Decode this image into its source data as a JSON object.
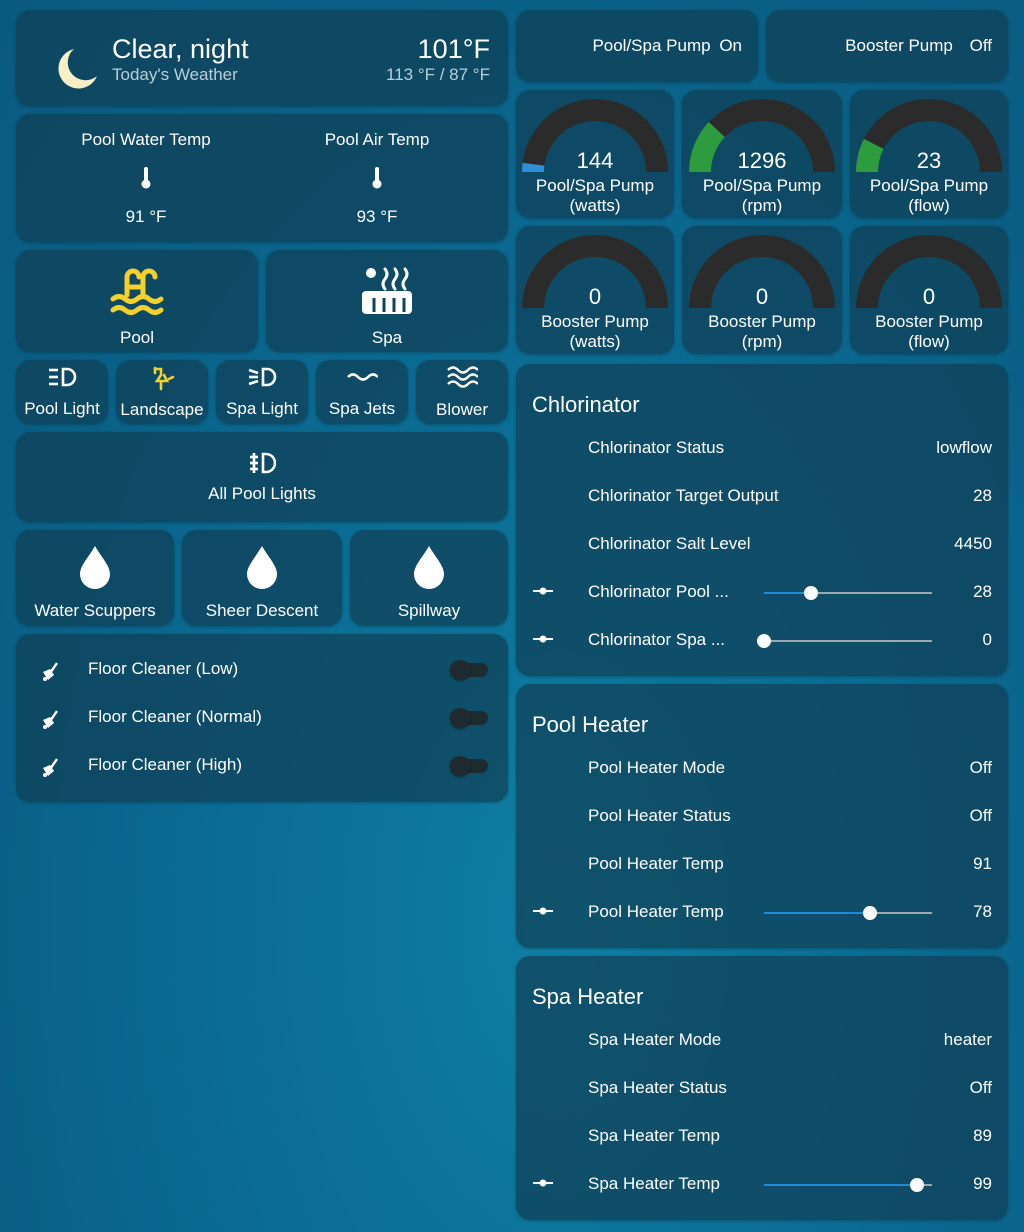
{
  "weather": {
    "condition": "Clear, night",
    "subtitle": "Today's Weather",
    "temperature": "101°F",
    "range": "113 °F / 87 °F",
    "icon": "moon-icon"
  },
  "temps": {
    "water_label": "Pool Water Temp",
    "water_value": "91 °F",
    "air_label": "Pool Air Temp",
    "air_value": "93 °F"
  },
  "modes": {
    "pool_label": "Pool",
    "spa_label": "Spa",
    "accent_color": "#f5d02c"
  },
  "lights": [
    {
      "label": "Pool Light",
      "icon": "headlight-icon"
    },
    {
      "label": "Landscape",
      "icon": "outdoor-lamp-icon"
    },
    {
      "label": "Spa Light",
      "icon": "headlight-icon"
    },
    {
      "label": "Spa Jets",
      "icon": "wave-icon"
    },
    {
      "label": "Blower",
      "icon": "waves-icon"
    }
  ],
  "all_lights": {
    "label": "All Pool Lights",
    "icon": "fog-light-icon"
  },
  "features": [
    {
      "label": "Water Scuppers",
      "icon": "water-drop-icon"
    },
    {
      "label": "Sheer Descent",
      "icon": "water-drop-icon"
    },
    {
      "label": "Spillway",
      "icon": "water-drop-icon"
    }
  ],
  "cleaners": [
    {
      "label": "Floor Cleaner (Low)",
      "state": "off"
    },
    {
      "label": "Floor Cleaner (Normal)",
      "state": "off"
    },
    {
      "label": "Floor Cleaner (High)",
      "state": "off"
    }
  ],
  "pumps": {
    "pool_spa": {
      "label": "Pool/Spa Pump",
      "state": "On"
    },
    "booster": {
      "label": "Booster Pump",
      "state": "Off"
    }
  },
  "gauges": [
    {
      "value": "144",
      "line1": "Pool/Spa Pump",
      "line2": "(watts)",
      "fraction": 0.04,
      "color": "#2f8fd8"
    },
    {
      "value": "1296",
      "line1": "Pool/Spa Pump",
      "line2": "(rpm)",
      "fraction": 0.24,
      "color": "#2e9b3e"
    },
    {
      "value": "23",
      "line1": "Pool/Spa Pump",
      "line2": "(flow)",
      "fraction": 0.15,
      "color": "#2e9b3e"
    },
    {
      "value": "0",
      "line1": "Booster Pump",
      "line2": "(watts)",
      "fraction": 0,
      "color": "#2e9b3e"
    },
    {
      "value": "0",
      "line1": "Booster Pump",
      "line2": "(rpm)",
      "fraction": 0,
      "color": "#2e9b3e"
    },
    {
      "value": "0",
      "line1": "Booster Pump",
      "line2": "(flow)",
      "fraction": 0,
      "color": "#2e9b3e"
    }
  ],
  "chlorinator": {
    "title": "Chlorinator",
    "rows": [
      {
        "name": "Chlorinator Status",
        "value": "lowflow"
      },
      {
        "name": "Chlorinator Target Output",
        "value": "28"
      },
      {
        "name": "Chlorinator Salt Level",
        "value": "4450"
      },
      {
        "name": "Chlorinator Pool ...",
        "value": "28",
        "slider": 0.28
      },
      {
        "name": "Chlorinator Spa ...",
        "value": "0",
        "slider": 0
      }
    ]
  },
  "pool_heater": {
    "title": "Pool Heater",
    "rows": [
      {
        "name": "Pool Heater Mode",
        "value": "Off"
      },
      {
        "name": "Pool Heater Status",
        "value": "Off"
      },
      {
        "name": "Pool Heater Temp",
        "value": "91"
      },
      {
        "name": "Pool Heater Temp",
        "value": "78",
        "slider": 0.63
      }
    ]
  },
  "spa_heater": {
    "title": "Spa Heater",
    "rows": [
      {
        "name": "Spa Heater Mode",
        "value": "heater"
      },
      {
        "name": "Spa Heater Status",
        "value": "Off"
      },
      {
        "name": "Spa Heater Temp",
        "value": "89"
      },
      {
        "name": "Spa Heater Temp",
        "value": "99",
        "slider": 0.91
      }
    ]
  }
}
